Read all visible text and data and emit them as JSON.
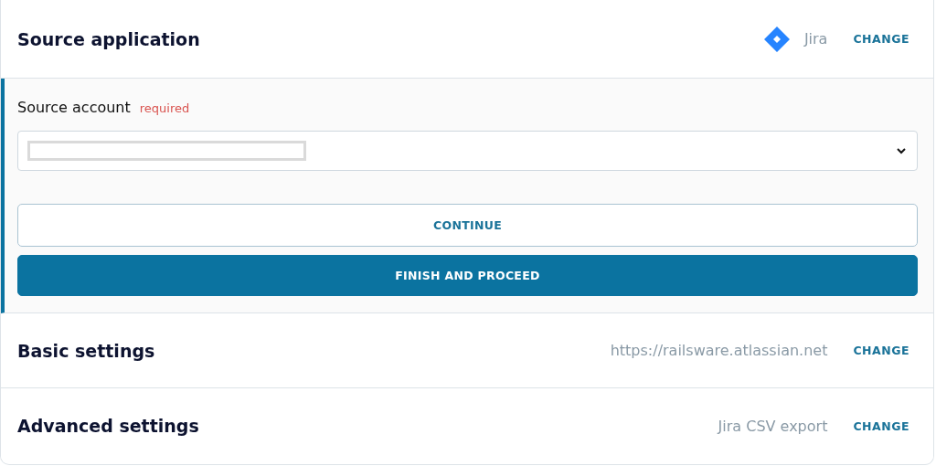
{
  "steps": [
    {
      "kind": "app",
      "title": "Source application",
      "value": "Jira",
      "action": "CHANGE"
    },
    {
      "kind": "form",
      "field": {
        "label": "Source account",
        "badge": "required"
      },
      "buttons": [
        {
          "label": "CONTINUE",
          "kind": "outline"
        },
        {
          "label": "FINISH AND PROCEED",
          "kind": "filled"
        }
      ]
    },
    {
      "kind": "text",
      "title": "Basic settings",
      "value": "https://railsware.atlassian.net",
      "action": "CHANGE"
    },
    {
      "kind": "text",
      "title": "Advanced settings",
      "value": "Jira CSV export",
      "action": "CHANGE"
    }
  ]
}
